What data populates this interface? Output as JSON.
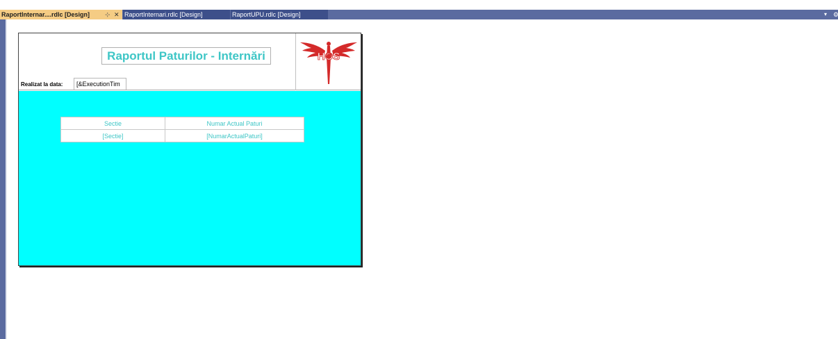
{
  "tabs": [
    {
      "label": "RaportInternar....rdlc [Design]",
      "active": true,
      "pin_icon": "pin-icon",
      "close_icon": "close-icon"
    },
    {
      "label": "RaportInternari.rdlc [Design]",
      "active": false
    },
    {
      "label": "RaportUPU.rdlc [Design]",
      "active": false
    }
  ],
  "tab_strip": {
    "dropdown_glyph": "▾",
    "settings_glyph": "⚙"
  },
  "report": {
    "title": "Raportul Paturilor - Internări",
    "date_label": "Realizat la data:",
    "date_value": "[&ExecutionTim",
    "logo_text": "HOS",
    "table": {
      "headers": [
        "Sectie",
        "Numar Actual Paturi"
      ],
      "rows": [
        [
          "[Sectie]",
          "[NumarActualPaturi]"
        ]
      ]
    }
  },
  "colors": {
    "tab_bar": "#5b6ba0",
    "active_tab": "#f5cc84",
    "body_background": "#00ffff",
    "accent_text": "#3ec6c6",
    "logo_red": "#d42a2a"
  }
}
